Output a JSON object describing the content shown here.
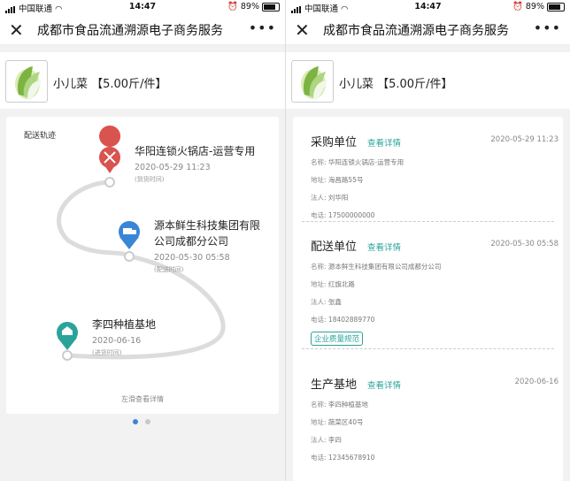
{
  "status": {
    "carrier": "中国联通",
    "time": "14:47",
    "battery": "89%"
  },
  "nav": {
    "title": "成都市食品流通溯源电子商务服务",
    "close": "✕",
    "more": "•••"
  },
  "product": {
    "name": "小儿菜 【5.00斤/件】"
  },
  "track": {
    "label": "配送轨迹",
    "stops": [
      {
        "name": "华阳连锁火锅店-运营专用",
        "date": "2020-05-29 11:23",
        "note": "(到货时间)",
        "icon": "utensils-icon",
        "color": "#d9534f"
      },
      {
        "name": "源本鲜生科技集团有限公司成都分公司",
        "date": "2020-05-30 05:58",
        "note": "(配送时间)",
        "icon": "truck-icon",
        "color": "#3a86d6"
      },
      {
        "name": "李四种植基地",
        "date": "2020-06-16",
        "note": "(进货时间)",
        "icon": "home-icon",
        "color": "#2aa39a"
      }
    ],
    "hint": "左滑查看详情"
  },
  "details": [
    {
      "title": "采购单位",
      "link": "查看详情",
      "date": "2020-05-29 11:23",
      "rows": [
        {
          "k": "名称: ",
          "v": "华阳连锁火锅店-运营专用"
        },
        {
          "k": "地址: ",
          "v": "海昌路55号"
        },
        {
          "k": "法人: ",
          "v": "刘华阳"
        },
        {
          "k": "电话: ",
          "v": "17500000000"
        }
      ]
    },
    {
      "title": "配送单位",
      "link": "查看详情",
      "date": "2020-05-30 05:58",
      "rows": [
        {
          "k": "名称: ",
          "v": "源本鲜生科技集团有限公司成都分公司"
        },
        {
          "k": "地址: ",
          "v": "红旗北路"
        },
        {
          "k": "法人: ",
          "v": "张鑫"
        },
        {
          "k": "电话: ",
          "v": "18402889770"
        }
      ],
      "badge": "企业质量规范"
    },
    {
      "title": "生产基地",
      "link": "查看详情",
      "date": "2020-06-16",
      "rows": [
        {
          "k": "名称: ",
          "v": "李四种植基地"
        },
        {
          "k": "地址: ",
          "v": "蔬菜区40号"
        },
        {
          "k": "法人: ",
          "v": "李四"
        },
        {
          "k": "电话: ",
          "v": "12345678910"
        }
      ]
    }
  ]
}
